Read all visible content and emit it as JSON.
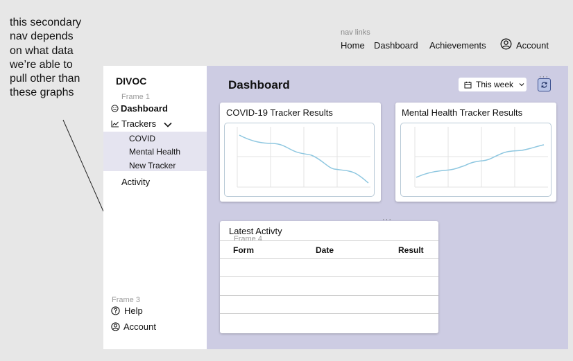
{
  "annotation": {
    "note": "this secondary nav depends on what data we’re able to pull other than these graphs"
  },
  "top_nav": {
    "caption": "nav links",
    "links": [
      "Home",
      "Dashboard",
      "Achievements",
      "Account"
    ]
  },
  "sidebar": {
    "brand": "DIVOC",
    "frame_label": "Frame 1",
    "dashboard": "Dashboard",
    "trackers": "Trackers",
    "sub_items": [
      "COVID",
      "Mental Health",
      "New Tracker"
    ],
    "activity": "Activity",
    "bottom_frame_label": "Frame 3",
    "help": "Help",
    "account": "Account"
  },
  "main": {
    "title": "Dashboard",
    "range_select": "This week",
    "cards": [
      {
        "title": "COVID-19 Tracker Results"
      },
      {
        "title": "Mental Health Tracker Results"
      }
    ],
    "activity": {
      "title": "Latest Activty",
      "frame_label": "Frame 4",
      "columns": [
        "Form",
        "Date",
        "Result"
      ]
    }
  },
  "colors": {
    "page_bg": "#e7e7e7",
    "main_bg": "#cdcce3",
    "sub_nav_bg": "#e5e4f0",
    "chart_line": "#8ec7e0"
  },
  "icons": [
    "face-icon",
    "chart-icon",
    "chevron-down-icon",
    "calendar-icon",
    "refresh-icon",
    "help-icon",
    "account-icon"
  ]
}
